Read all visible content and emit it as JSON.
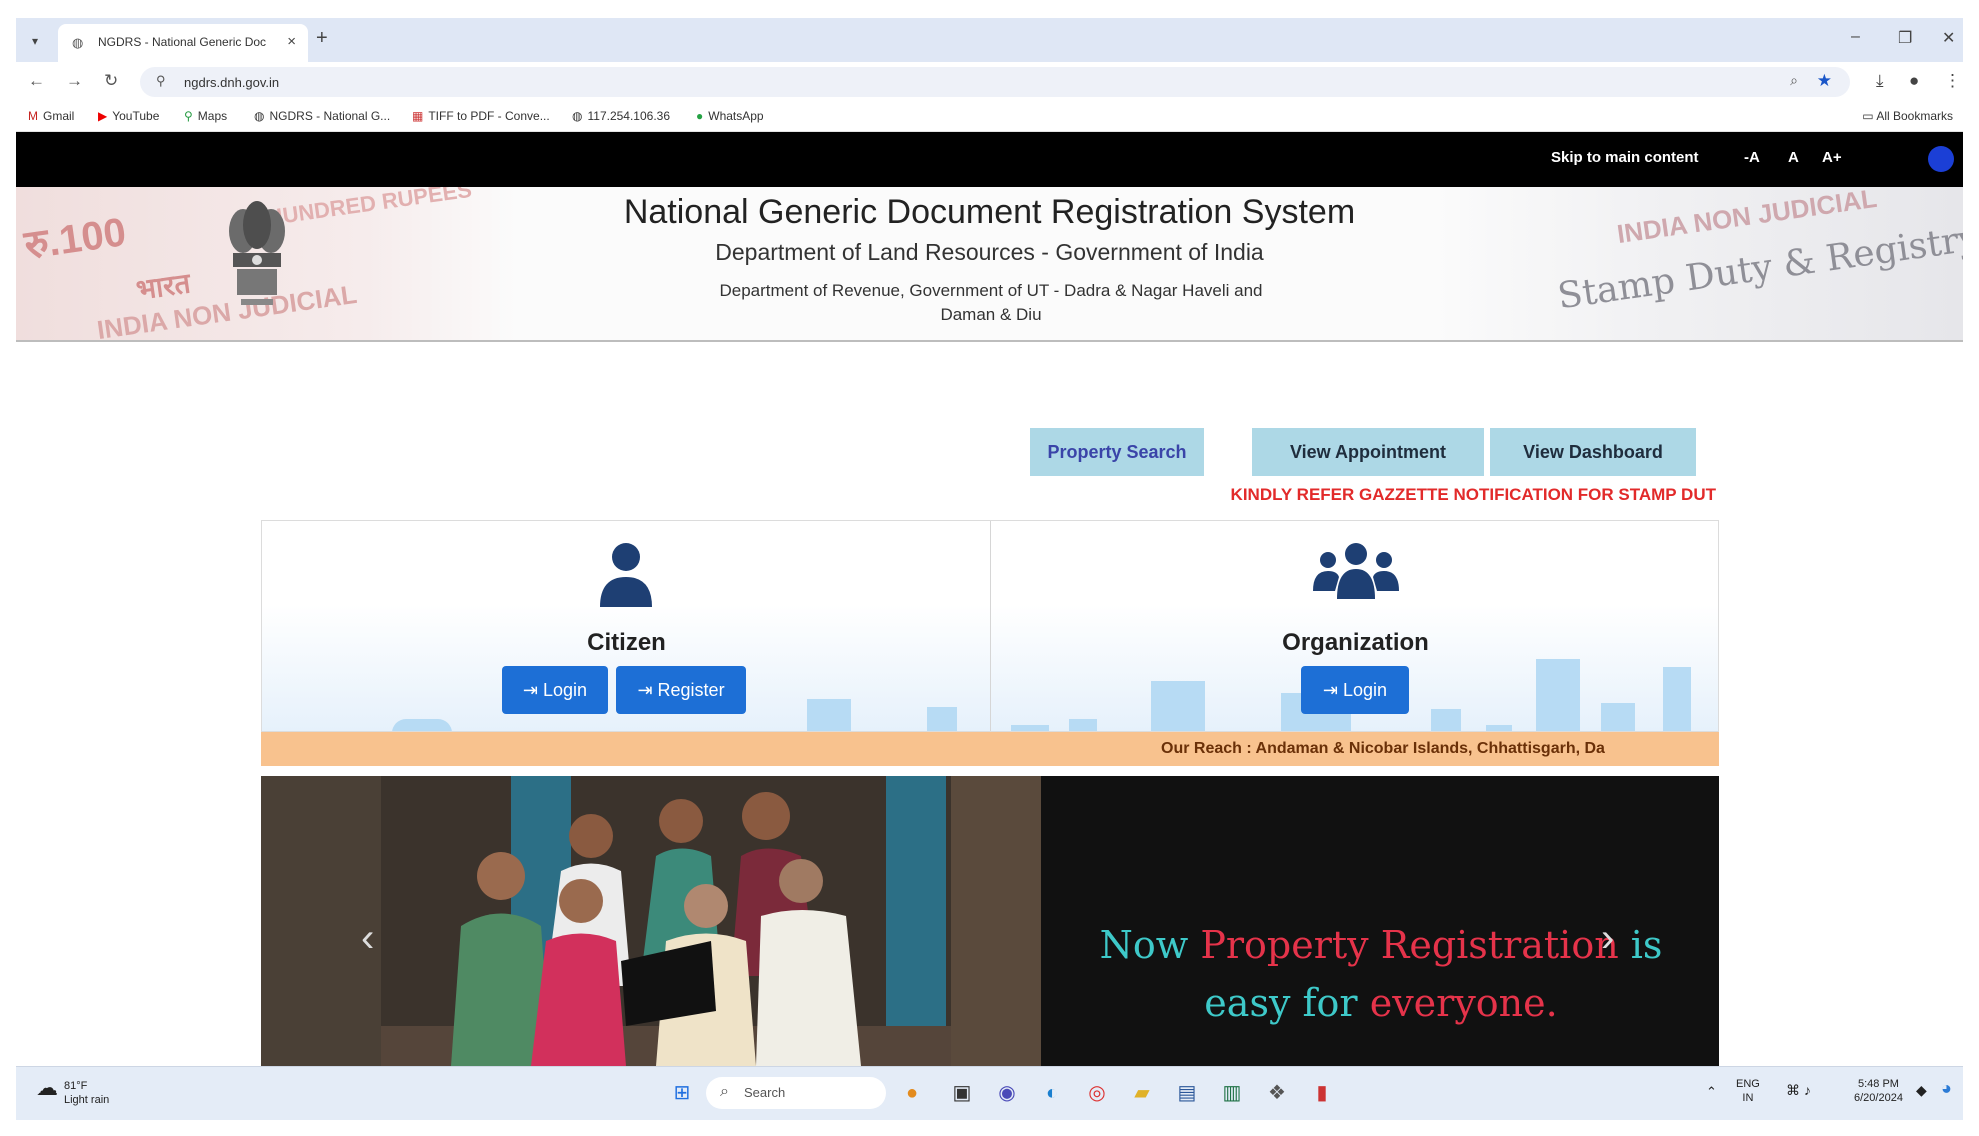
{
  "browser": {
    "tab_title": "NGDRS - National Generic Doc",
    "url": "ngdrs.dnh.gov.in",
    "bookmarks": [
      {
        "label": "Gmail",
        "icon": "gmail-icon"
      },
      {
        "label": "YouTube",
        "icon": "youtube-icon"
      },
      {
        "label": "Maps",
        "icon": "maps-icon"
      },
      {
        "label": "NGDRS - National G...",
        "icon": "globe-icon"
      },
      {
        "label": "TIFF to PDF - Conve...",
        "icon": "tiff-icon"
      },
      {
        "label": "117.254.106.36",
        "icon": "globe-icon"
      },
      {
        "label": "WhatsApp",
        "icon": "whatsapp-icon"
      }
    ],
    "all_bookmarks": "All Bookmarks"
  },
  "topbar": {
    "skip_label": "Skip to main content",
    "font_decrease": "-A",
    "font_normal": "A",
    "font_increase": "A+"
  },
  "header": {
    "title": "National Generic Document Registration System",
    "subtitle": "Department of Land Resources - Government of India",
    "department": "Department of Revenue, Government of UT - Dadra & Nagar Haveli and Daman & Diu",
    "stamp_left_amount": "रु.100",
    "stamp_left_line1": "HUNDRED RUPEES",
    "stamp_left_line2": "भारत",
    "stamp_left_line3": "INDIA NON JUDICIAL",
    "stamp_right_line": "INDIA NON JUDICIAL",
    "stamp_right_text": "Stamp Duty & Registry"
  },
  "quick_links": {
    "property_search": "Property Search",
    "view_appointment": "View Appointment",
    "view_dashboard": "View Dashboard"
  },
  "notice": "KINDLY REFER GAZZETTE NOTIFICATION FOR STAMP DUT",
  "citizen": {
    "title": "Citizen",
    "login": "Login",
    "register": "Register"
  },
  "organization": {
    "title": "Organization",
    "login": "Login"
  },
  "reach_text": "Our Reach : Andaman & Nicobar Islands,  Chhattisgarh, Da",
  "banner": {
    "t1": "Now",
    "t2": "Property Registration",
    "t3": "is",
    "t4": "easy for",
    "t5": "everyone."
  },
  "taskbar": {
    "weather_temp": "81°F",
    "weather_desc": "Light rain",
    "search_placeholder": "Search",
    "lang_top": "ENG",
    "lang_bottom": "IN",
    "time": "5:48 PM",
    "date": "6/20/2024"
  },
  "colors": {
    "quick_button_bg": "#add8e6",
    "notice_red": "#e22a2a",
    "login_blue": "#1d6fd6",
    "reach_bar": "#f8c28e",
    "banner_teal": "#3ec9c9",
    "banner_red": "#e5334a"
  }
}
